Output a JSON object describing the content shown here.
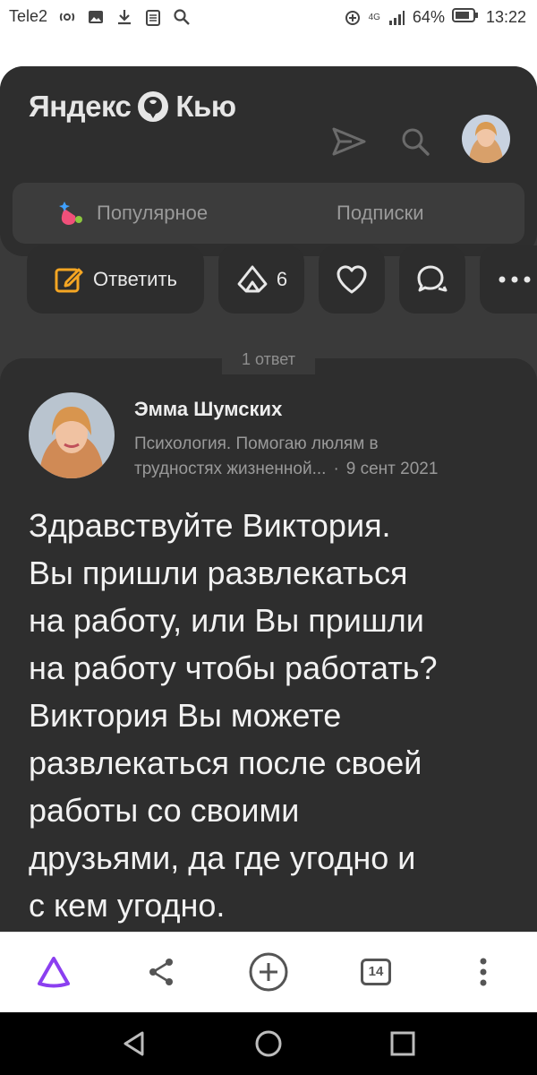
{
  "status_bar": {
    "carrier": "Tele2",
    "network": "4G",
    "battery": "64%",
    "time": "13:22",
    "icons": [
      "hotspot-icon",
      "image-icon",
      "download-icon",
      "clipboard-icon",
      "search-icon",
      "data-saver-icon",
      "signal-icon",
      "battery-icon"
    ]
  },
  "header": {
    "logo_part1": "Яндекс",
    "logo_part2": "Кью",
    "icons": [
      "send-icon",
      "search-icon",
      "avatar"
    ]
  },
  "tabs": [
    {
      "label": "Популярное",
      "icon": "sparkle-drop-icon"
    },
    {
      "label": "Подписки"
    }
  ],
  "actions": {
    "reply_label": "Ответить",
    "upvote_count": "6",
    "icons": [
      "edit-icon",
      "upvote-icon",
      "heart-icon",
      "comments-icon",
      "more-icon"
    ]
  },
  "answers": {
    "count_label": "1 ответ",
    "items": [
      {
        "author": "Эмма Шумских",
        "bio_line1": "Психология. Помогаю люлям в",
        "bio_line2": "трудностях жизненной...",
        "date": "9 сент 2021",
        "text_lines": [
          "Здравствуйте Виктория.",
          "Вы пришли развлекаться",
          "на работу, или Вы пришли",
          "на работу чтобы работать?",
          "Виктория Вы можете",
          "развлекаться после своей",
          "работы со своими",
          "друзьями, да где угодно и",
          "с кем угодно."
        ]
      }
    ]
  },
  "browser_bar": {
    "tab_count": "14",
    "icons": [
      "alice-icon",
      "share-icon",
      "add-icon",
      "tabs-icon",
      "menu-icon"
    ],
    "alice_color": "#8b3ff0"
  },
  "nav_bar": {
    "icons": [
      "back-icon",
      "home-icon",
      "recent-apps-icon"
    ]
  },
  "colors": {
    "sheet_bg": "#3a3a3a",
    "card_bg": "#2e2e2e",
    "accent_orange": "#f5a623"
  }
}
